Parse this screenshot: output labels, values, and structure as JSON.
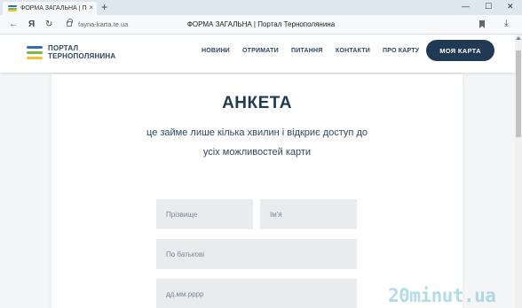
{
  "browser": {
    "tab_title": "ФОРМА ЗАГАЛЬНА | П",
    "tab_close": "×",
    "new_tab": "+",
    "window_controls": {
      "minimize": "—",
      "maximize": "☐",
      "close": "✕"
    },
    "nav": {
      "back": "←",
      "yandex": "Я",
      "reload": "↻"
    },
    "url": "fayna-karta.te.ua",
    "page_title": "ФОРМА ЗАГАЛЬНА | Портал Тернополянина",
    "download": "⤓"
  },
  "site": {
    "logo": {
      "line1": "ПОРТАЛ",
      "line2": "ТЕРНОПОЛЯНИНА",
      "colors": [
        "#2e6fb5",
        "#78b944",
        "#f2c32f"
      ]
    },
    "nav_items": [
      "НОВИНИ",
      "ОТРИМАТИ",
      "ПИТАННЯ",
      "КОНТАКТИ",
      "ПРО КАРТУ"
    ],
    "cta_button": "МОЯ КАРТА",
    "colors": {
      "primary": "#213a54",
      "field_bg": "#e9ebed"
    }
  },
  "form": {
    "title": "АНКЕТА",
    "subtitle_line1": "це займе лише кілька хвилин і відкриє доступ до",
    "subtitle_line2": "усіх можливостей карти",
    "fields": {
      "surname_placeholder": "Прізвище",
      "name_placeholder": "Ім'я",
      "patronymic_placeholder": "По батькові",
      "birthdate_placeholder": "дд.мм.рррр"
    }
  },
  "watermark": "20minut.ua"
}
